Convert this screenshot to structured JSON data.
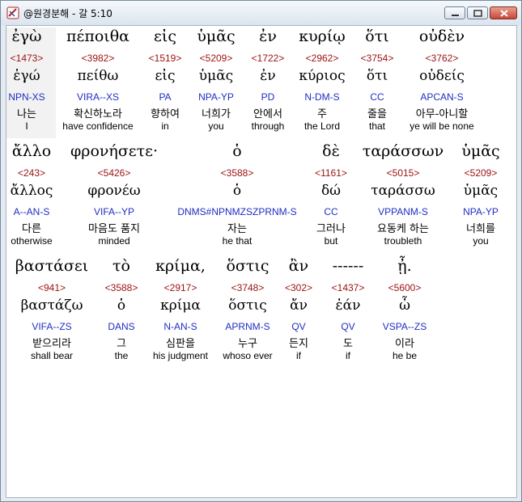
{
  "window": {
    "title": "@원경분해 - 갈 5:10",
    "controls": {
      "minimize": "minimize",
      "maximize": "maximize",
      "close": "close"
    }
  },
  "verses": [
    {
      "words": [
        {
          "greek": "ἐγὼ",
          "strong": "<1473>",
          "lemma": "ἐγώ",
          "parsing": "NPN-XS",
          "korean": "나는",
          "english": "I"
        },
        {
          "greek": "πέποιθα",
          "strong": "<3982>",
          "lemma": "πείθω",
          "parsing": "VIRA--XS",
          "korean": "확신하노라",
          "english": "have confidence"
        },
        {
          "greek": "εἰς",
          "strong": "<1519>",
          "lemma": "εἰς",
          "parsing": "PA",
          "korean": "향하여",
          "english": "in"
        },
        {
          "greek": "ὑμᾶς",
          "strong": "<5209>",
          "lemma": "ὑμᾶς",
          "parsing": "NPA-YP",
          "korean": "너희가",
          "english": "you"
        },
        {
          "greek": "ἐν",
          "strong": "<1722>",
          "lemma": "ἐν",
          "parsing": "PD",
          "korean": "안에서",
          "english": "through"
        },
        {
          "greek": "κυρίῳ",
          "strong": "<2962>",
          "lemma": "κύριος",
          "parsing": "N-DM-S",
          "korean": "주",
          "english": "the Lord"
        },
        {
          "greek": "ὅτι",
          "strong": "<3754>",
          "lemma": "ὅτι",
          "parsing": "CC",
          "korean": "줄을",
          "english": "that"
        },
        {
          "greek": "οὐδὲν",
          "strong": "<3762>",
          "lemma": "οὐδείς",
          "parsing": "APCAN-S",
          "korean": "아무-아니할",
          "english": "ye will be none"
        }
      ]
    },
    {
      "words": [
        {
          "greek": "ἄλλο",
          "strong": "<243>",
          "lemma": "ἄλλος",
          "parsing": "A--AN-S",
          "korean": "다른",
          "english": "otherwise"
        },
        {
          "greek": "φρονήσετε·",
          "strong": "<5426>",
          "lemma": "φρονέω",
          "parsing": "VIFA--YP",
          "korean": "마음도 품지",
          "english": "minded"
        },
        {
          "greek": "ὁ",
          "strong": "<3588>",
          "lemma": "ὁ",
          "parsing": "DNMS#NPNMZSZPRNM-S",
          "korean": "자는",
          "english": "he that"
        },
        {
          "greek": "δὲ",
          "strong": "<1161>",
          "lemma": "δώ",
          "parsing": "CC",
          "korean": "그러나",
          "english": "but"
        },
        {
          "greek": "ταράσσων",
          "strong": "<5015>",
          "lemma": "ταράσσω",
          "parsing": "VPPANM-S",
          "korean": "요동케 하는",
          "english": "troubleth"
        },
        {
          "greek": "ὑμᾶς",
          "strong": "<5209>",
          "lemma": "ὑμᾶς",
          "parsing": "NPA-YP",
          "korean": "너희를",
          "english": "you"
        }
      ]
    },
    {
      "words": [
        {
          "greek": "βαστάσει",
          "strong": "<941>",
          "lemma": "βαστάζω",
          "parsing": "VIFA--ZS",
          "korean": "받으리라",
          "english": "shall bear"
        },
        {
          "greek": "τὸ",
          "strong": "<3588>",
          "lemma": "ὁ",
          "parsing": "DANS",
          "korean": "그",
          "english": "the"
        },
        {
          "greek": "κρίμα,",
          "strong": "<2917>",
          "lemma": "κρίμα",
          "parsing": "N-AN-S",
          "korean": "심판을",
          "english": "his judgment"
        },
        {
          "greek": "ὅστις",
          "strong": "<3748>",
          "lemma": "ὅστις",
          "parsing": "APRNM-S",
          "korean": "누구",
          "english": "whoso ever"
        },
        {
          "greek": "ἂν",
          "strong": "<302>",
          "lemma": "ἄν",
          "parsing": "QV",
          "korean": "든지",
          "english": "if"
        },
        {
          "greek": "------",
          "strong": "<1437>",
          "lemma": "ἐάν",
          "parsing": "QV",
          "korean": "도",
          "english": "if"
        },
        {
          "greek": "ᾖ.",
          "strong": "<5600>",
          "lemma": "ὦ",
          "parsing": "VSPA--ZS",
          "korean": "이라",
          "english": "he be"
        }
      ]
    }
  ]
}
